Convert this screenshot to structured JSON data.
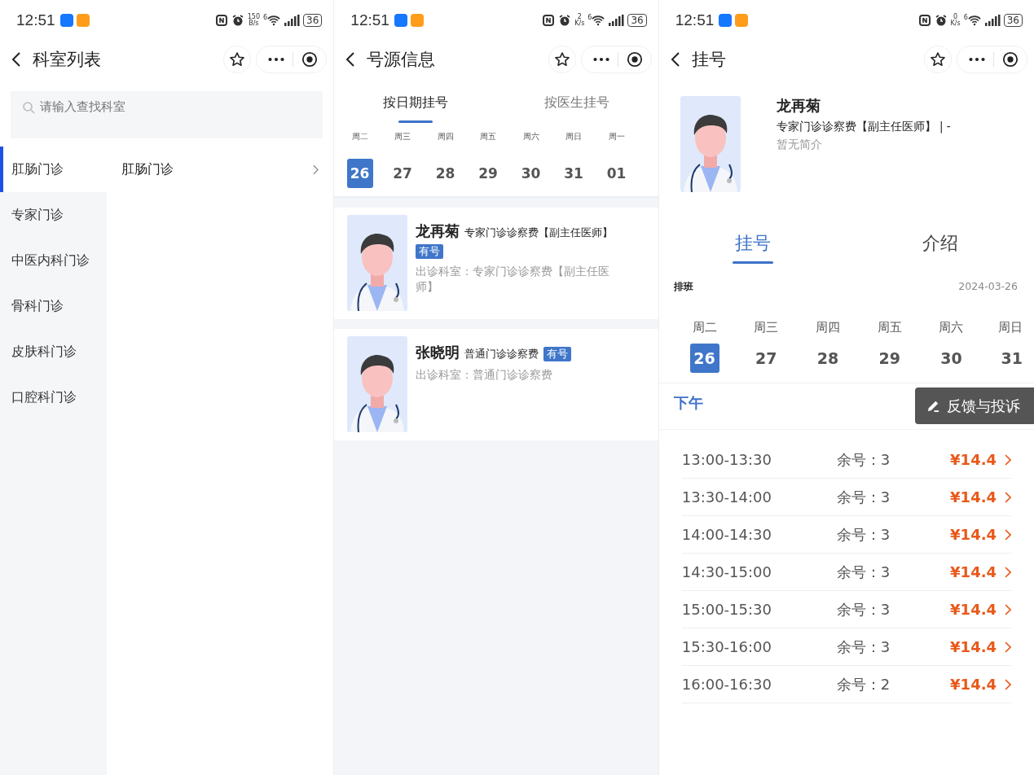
{
  "screens": [
    {
      "kind": "department_list",
      "status": {
        "time": "12:51",
        "speed_value": "150",
        "speed_unit": "B/s",
        "wifi_label": "6",
        "battery": "36"
      },
      "nav": {
        "title": "科室列表"
      },
      "search": {
        "placeholder": "请输入查找科室"
      },
      "categories": [
        {
          "label": "肛肠门诊",
          "selected": true
        },
        {
          "label": "专家门诊",
          "selected": false
        },
        {
          "label": "中医内科门诊",
          "selected": false
        },
        {
          "label": "骨科门诊",
          "selected": false
        },
        {
          "label": "皮肤科门诊",
          "selected": false
        },
        {
          "label": "口腔科门诊",
          "selected": false
        }
      ],
      "departments": [
        {
          "label": "肛肠门诊"
        }
      ]
    },
    {
      "kind": "source_info",
      "status": {
        "time": "12:51",
        "speed_value": "2",
        "speed_unit": "K/s",
        "wifi_label": "6",
        "battery": "36"
      },
      "nav": {
        "title": "号源信息"
      },
      "tabs": [
        {
          "label": "按日期挂号",
          "selected": true
        },
        {
          "label": "按医生挂号",
          "selected": false
        }
      ],
      "days": [
        {
          "weekday": "周二",
          "date": "26",
          "selected": true
        },
        {
          "weekday": "周三",
          "date": "27",
          "selected": false
        },
        {
          "weekday": "周四",
          "date": "28",
          "selected": false
        },
        {
          "weekday": "周五",
          "date": "29",
          "selected": false
        },
        {
          "weekday": "周六",
          "date": "30",
          "selected": false
        },
        {
          "weekday": "周日",
          "date": "31",
          "selected": false
        },
        {
          "weekday": "周一",
          "date": "01",
          "selected": false
        }
      ],
      "doctors": [
        {
          "name": "龙再菊",
          "fee": "专家门诊诊察费【副主任医师】",
          "badge": "有号",
          "department": "出诊科室：专家门诊诊察费【副主任医师】"
        },
        {
          "name": "张晓明",
          "fee": "普通门诊诊察费",
          "badge": "有号",
          "department": "出诊科室：普通门诊诊察费"
        }
      ]
    },
    {
      "kind": "register",
      "status": {
        "time": "12:51",
        "speed_value": "0",
        "speed_unit": "K/s",
        "wifi_label": "6",
        "battery": "36"
      },
      "nav": {
        "title": "挂号"
      },
      "doctor": {
        "name": "龙再菊",
        "title": "专家门诊诊察费【副主任医师】 | -",
        "intro": "暂无简介"
      },
      "tabs": [
        {
          "label": "挂号",
          "selected": true
        },
        {
          "label": "介绍",
          "selected": false
        }
      ],
      "schedule": {
        "label": "排班",
        "date": "2024-03-26"
      },
      "days": [
        {
          "weekday": "周二",
          "date": "26",
          "selected": true
        },
        {
          "weekday": "周三",
          "date": "27",
          "selected": false
        },
        {
          "weekday": "周四",
          "date": "28",
          "selected": false
        },
        {
          "weekday": "周五",
          "date": "29",
          "selected": false
        },
        {
          "weekday": "周六",
          "date": "30",
          "selected": false
        },
        {
          "weekday": "周日",
          "date": "31",
          "selected": false
        }
      ],
      "period": "下午",
      "slots": [
        {
          "time": "13:00-13:30",
          "remaining": "余号：3",
          "price": "¥14.4"
        },
        {
          "time": "13:30-14:00",
          "remaining": "余号：3",
          "price": "¥14.4"
        },
        {
          "time": "14:00-14:30",
          "remaining": "余号：3",
          "price": "¥14.4"
        },
        {
          "time": "14:30-15:00",
          "remaining": "余号：3",
          "price": "¥14.4"
        },
        {
          "time": "15:00-15:30",
          "remaining": "余号：3",
          "price": "¥14.4"
        },
        {
          "time": "15:30-16:00",
          "remaining": "余号：3",
          "price": "¥14.4"
        },
        {
          "time": "16:00-16:30",
          "remaining": "余号：2",
          "price": "¥14.4"
        }
      ],
      "feedback": "反馈与投诉"
    }
  ]
}
